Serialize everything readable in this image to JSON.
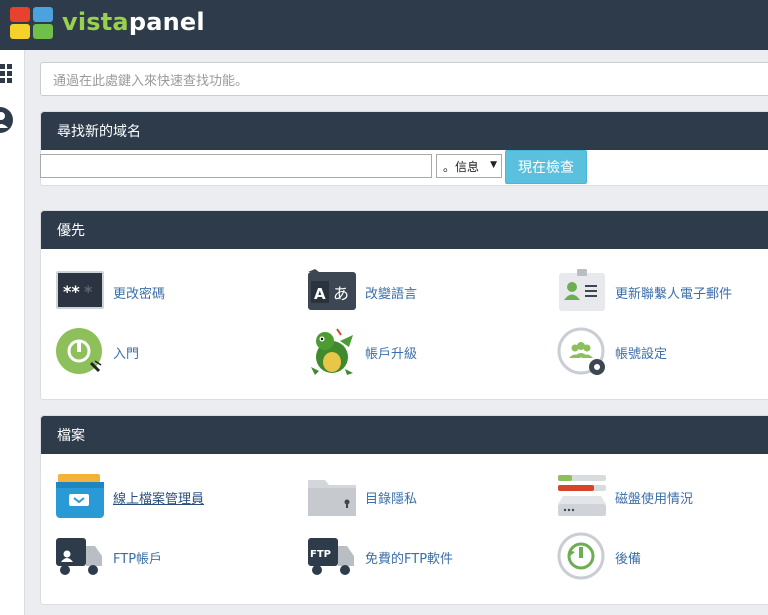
{
  "app": {
    "logo_prefix": "vista",
    "logo_suffix": "panel"
  },
  "search": {
    "placeholder": "通過在此處鍵入來快速查找功能。"
  },
  "domain_panel": {
    "title": "尋找新的域名",
    "tld_selected": "。信息",
    "check_button": "現在檢查"
  },
  "preferences": {
    "title": "優先",
    "items": [
      {
        "label": "更改密碼",
        "icon": "password-icon"
      },
      {
        "label": "改變語言",
        "icon": "language-icon"
      },
      {
        "label": "更新聯繫人電子郵件",
        "icon": "contact-card-icon"
      },
      {
        "label": "入門",
        "icon": "getting-started-icon"
      },
      {
        "label": "帳戶升級",
        "icon": "dragon-mascot-icon"
      },
      {
        "label": "帳號設定",
        "icon": "account-settings-icon"
      }
    ]
  },
  "files": {
    "title": "檔案",
    "items": [
      {
        "label": "線上檔案管理員",
        "icon": "file-manager-icon"
      },
      {
        "label": "目錄隱私",
        "icon": "locked-folder-icon"
      },
      {
        "label": "磁盤使用情況",
        "icon": "disk-usage-icon"
      },
      {
        "label": "FTP帳戶",
        "icon": "ftp-account-icon"
      },
      {
        "label": "免費的FTP軟件",
        "icon": "ftp-software-icon"
      },
      {
        "label": "後備",
        "icon": "backup-icon"
      }
    ]
  },
  "colors": {
    "topbar": "#2d3b4b",
    "accent_button": "#5bc0de",
    "link": "#3b6fa8"
  }
}
